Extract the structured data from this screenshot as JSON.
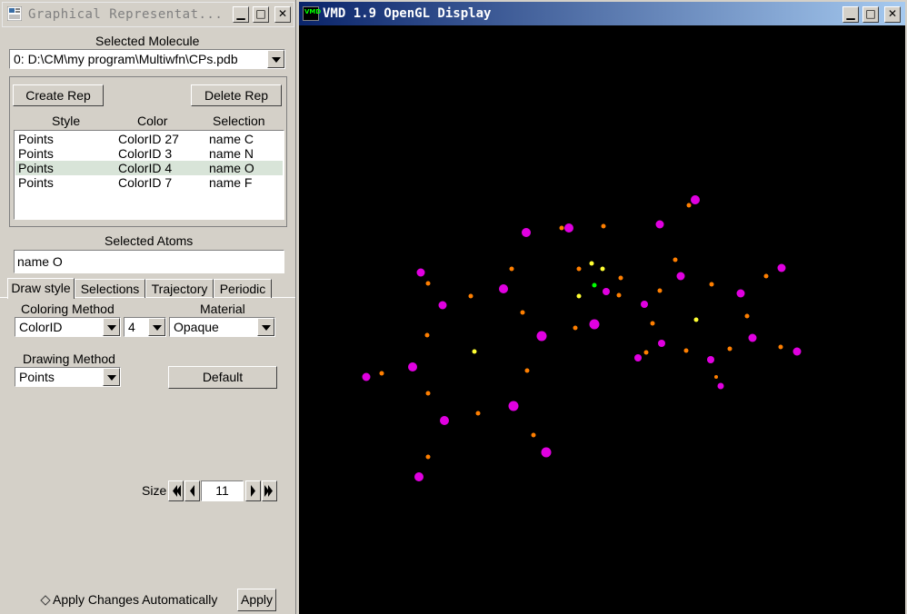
{
  "left_window": {
    "title": "Graphical Representat...",
    "selected_molecule_label": "Selected Molecule",
    "selected_molecule_value": "0: D:\\CM\\my program\\Multiwfn\\CPs.pdb",
    "create_rep": "Create Rep",
    "delete_rep": "Delete Rep",
    "columns": {
      "style": "Style",
      "color": "Color",
      "selection": "Selection"
    },
    "reps": [
      {
        "style": "Points",
        "color": "ColorID 27",
        "selection": "name C",
        "selected": false
      },
      {
        "style": "Points",
        "color": "ColorID 3",
        "selection": "name N",
        "selected": false
      },
      {
        "style": "Points",
        "color": "ColorID 4",
        "selection": "name O",
        "selected": true
      },
      {
        "style": "Points",
        "color": "ColorID 7",
        "selection": "name F",
        "selected": false
      }
    ],
    "selected_atoms_label": "Selected Atoms",
    "selected_atoms_value": "name O",
    "tabs": [
      "Draw style",
      "Selections",
      "Trajectory",
      "Periodic"
    ],
    "active_tab": 0,
    "coloring_method_label": "Coloring Method",
    "coloring_method_value": "ColorID",
    "color_id_value": "4",
    "material_label": "Material",
    "material_value": "Opaque",
    "drawing_method_label": "Drawing Method",
    "drawing_method_value": "Points",
    "default_button": "Default",
    "size_label": "Size",
    "size_value": "11",
    "apply_auto_label": "Apply Changes Automatically",
    "apply_button": "Apply"
  },
  "right_window": {
    "title": "VMD 1.9 OpenGL Display",
    "icon_text": "VMD"
  },
  "colors": {
    "magenta": "#e000e0",
    "orange": "#ff7f00",
    "yellow": "#ffff33",
    "green": "#00ff00",
    "background": "#000000"
  }
}
